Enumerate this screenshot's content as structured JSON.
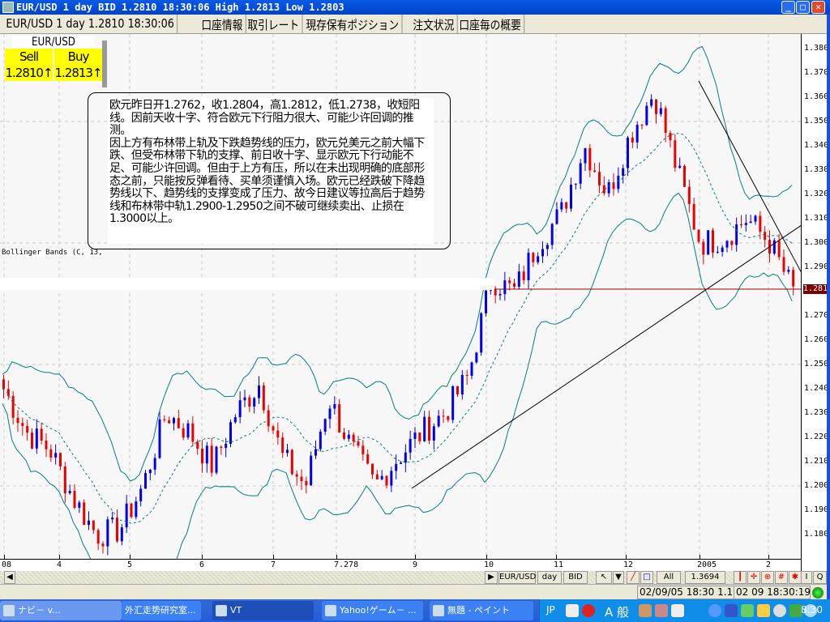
{
  "window": {
    "title": "EUR/USD 1 day BID 1.2810 18:30:06 High 1.2813 Low 1.2803"
  },
  "tabs": [
    {
      "label": "EUR/USD 1 day 1.2810 18:30:06",
      "active": true
    },
    {
      "label": "口座情報"
    },
    {
      "label": "取引レート"
    },
    {
      "label": "現存保有ポジション"
    },
    {
      "label": "注文状況"
    },
    {
      "label": "口座毎の概要"
    }
  ],
  "quote": {
    "pair": "EUR/USD",
    "sell_label": "Sell",
    "buy_label": "Buy",
    "sell": "1.2810↑",
    "buy": "1.2813↑"
  },
  "note": {
    "text": "欧元昨日开1.2762，收1.2804，高1.2812，低1.2738，收短阳线。因前天收十字、符合欧元下行阻力很大、可能少许回调的推测。\n因上方有布林带上轨及下跌趋势线的压力，欧元兑美元之前大幅下跌、但受布林带下轨的支撑、前日收十字、显示欧元下行动能不足、可能少许回调。但由于上方有压，所以在未出现明确的底部形态之前，只能按反弹看待、买单须谨慎入场。欧元已经跌破下降趋势线以下、趋势线的支撑变成了压力、故今日建议等拉高后于趋势线和布林带中轨1.2900-1.2950之间不破可继续卖出、止损在1.3000以上。"
  },
  "indicator_label": "Bollinger Bands (C, 13,",
  "chart": {
    "type": "candlestick",
    "y_ticks": [
      "1.3800",
      "1.3700",
      "1.3600",
      "1.3500",
      "1.3400",
      "1.3300",
      "1.3200",
      "1.3100",
      "1.3000",
      "1.2900",
      "1.2700",
      "1.2600",
      "1.2500",
      "1.2400",
      "1.2300",
      "1.2200",
      "1.2100",
      "1.2000",
      "1.1900",
      "1.1800"
    ],
    "ylim": [
      1.175,
      1.3875
    ],
    "current_price": "1.2810",
    "x_ticks": [
      "08",
      "4",
      "5",
      "6",
      "7",
      "7.278",
      "9",
      "10",
      "11",
      "12",
      "2005",
      "2"
    ],
    "close_path": [
      1.24,
      1.222,
      1.215,
      1.195,
      1.18,
      1.182,
      1.2,
      1.23,
      1.222,
      1.208,
      1.23,
      1.242,
      1.212,
      1.2,
      1.236,
      1.215,
      1.2,
      1.212,
      1.222,
      1.23,
      1.245,
      1.285,
      1.28,
      1.3,
      1.312,
      1.34,
      1.32,
      1.345,
      1.362,
      1.33,
      1.3,
      1.302,
      1.31,
      1.3,
      1.28
    ],
    "bollinger_period": 13,
    "colors": {
      "up": "#0000ee",
      "down": "#ee0000",
      "band": "#008080",
      "price_line": "#990000"
    }
  },
  "toolbar": {
    "symbol": "EUR/USD",
    "period": "day",
    "side": "BID",
    "range": "All",
    "value": "1.3694",
    "q": "Q"
  },
  "status": {
    "cursor": "02/09/05 18:30  1.1807",
    "time": "02 09 18:30:19"
  },
  "taskbar": {
    "items": [
      "ナビ－ v...",
      "外汇走势研究室...",
      "VT",
      "Yahoo!ゲーム－ ...",
      "無題 - ペイント"
    ],
    "ime": "JP",
    "ime_mode": "A 般",
    "clock": "8:30"
  }
}
